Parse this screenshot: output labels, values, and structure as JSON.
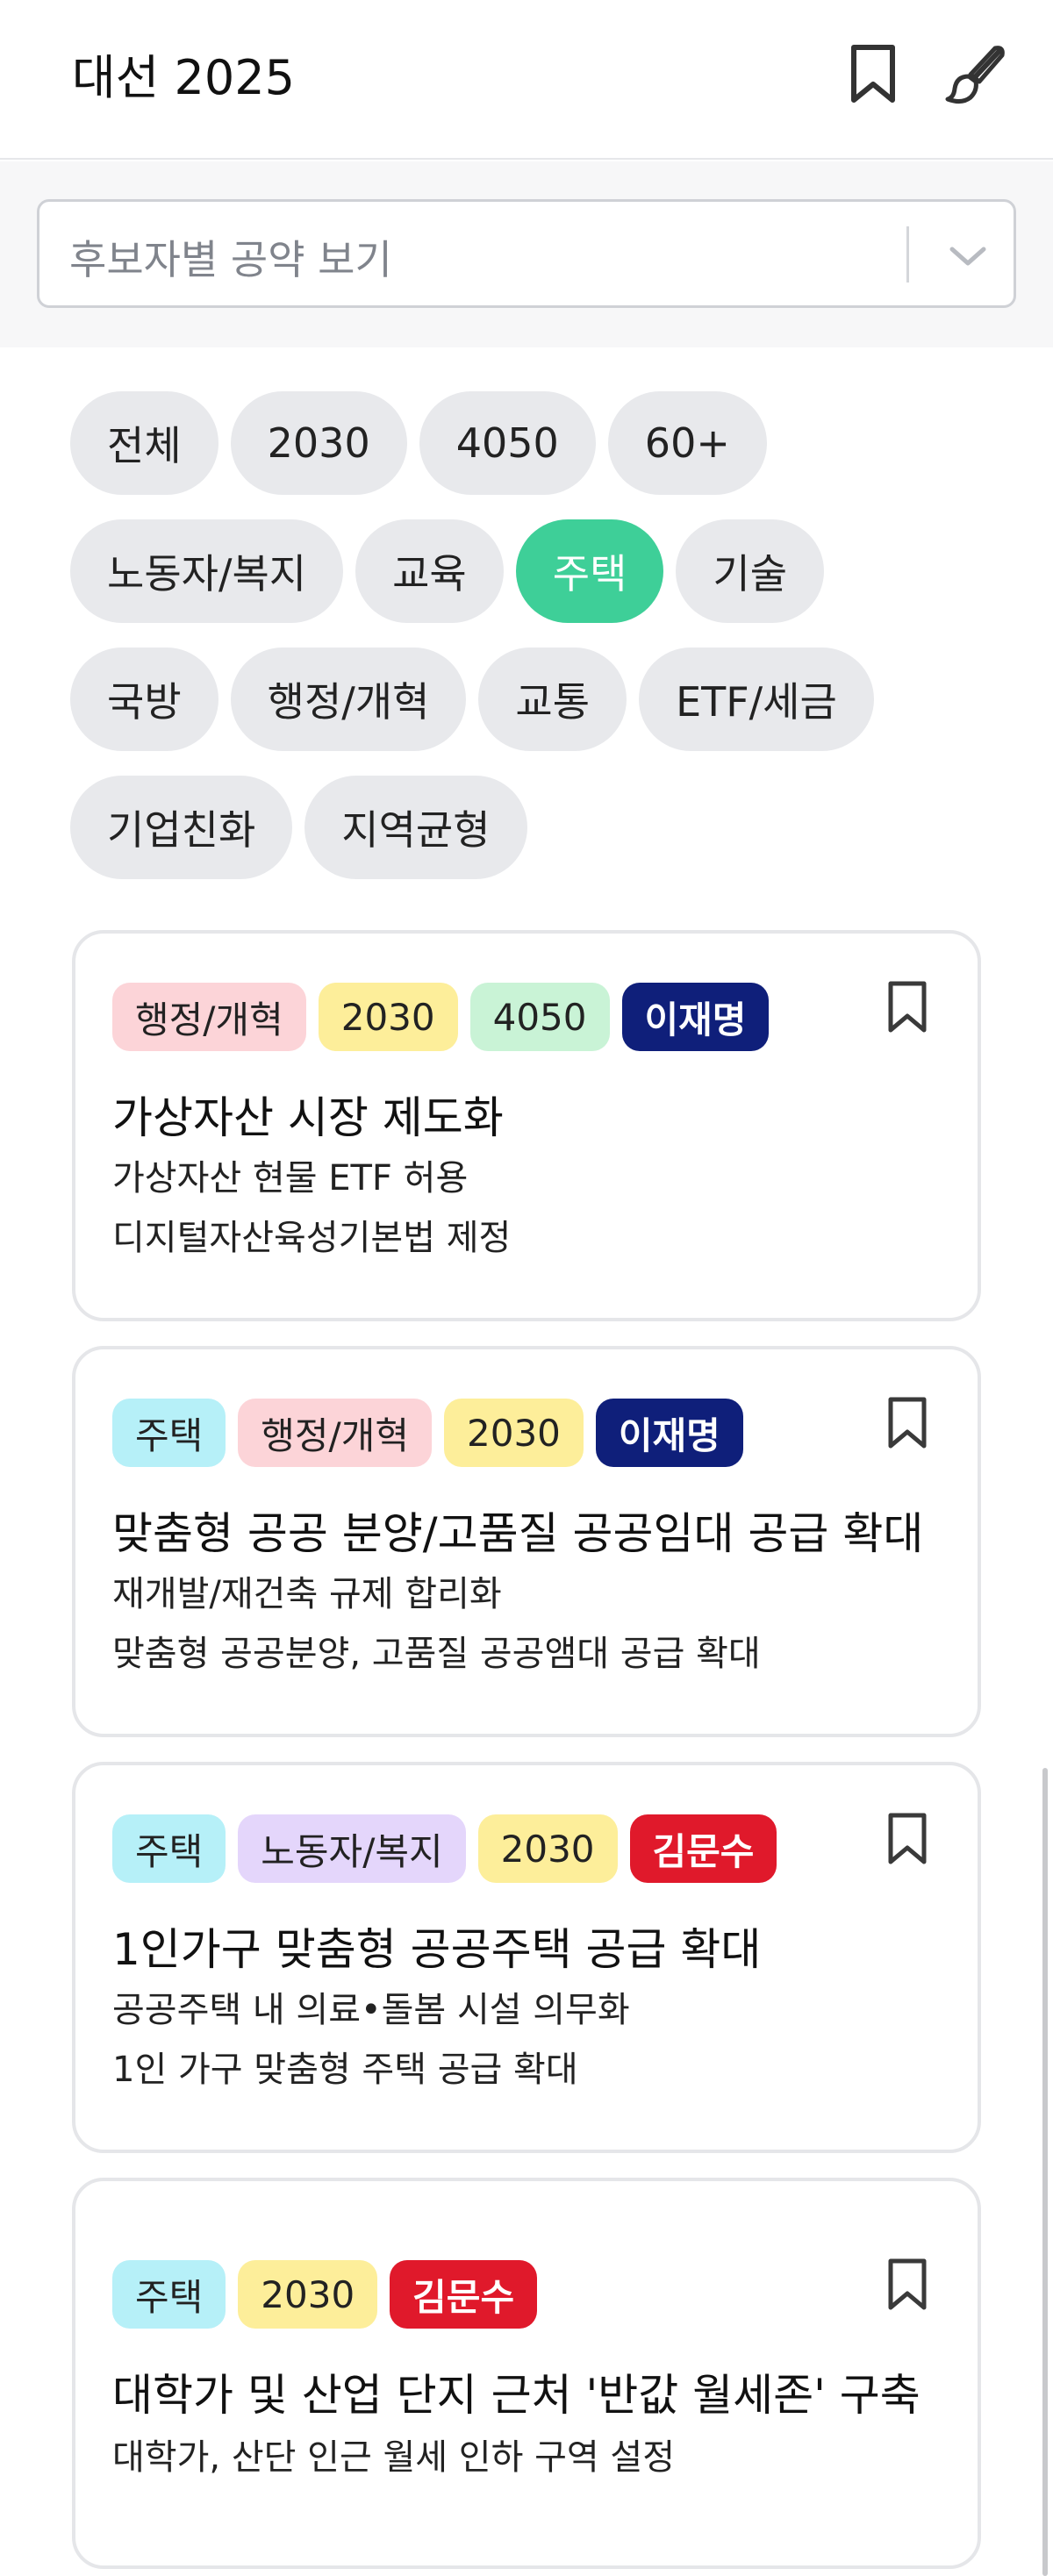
{
  "header": {
    "title": "대선 2025"
  },
  "select": {
    "placeholder": "후보자별 공약 보기"
  },
  "filters": {
    "rows": [
      [
        "전체",
        "2030",
        "4050",
        "60+"
      ],
      [
        "노동자/복지",
        "교육",
        "주택",
        "기술"
      ],
      [
        "국방",
        "행정/개혁",
        "교통",
        "ETF/세금"
      ],
      [
        "기업친화",
        "지역균형"
      ]
    ],
    "active": "주택"
  },
  "colors": {
    "accent": "#3ecf98",
    "tag_admin": "#fcd4d8",
    "tag_2030": "#fdee9a",
    "tag_4050": "#c9f3d6",
    "tag_housing": "#b6f0f8",
    "tag_labor": "#e4d6fb",
    "cand_lee": "#0f1f7a",
    "cand_kim": "#e0192b"
  },
  "cards": [
    {
      "tags": [
        {
          "label": "행정/개혁",
          "kind": "admin"
        },
        {
          "label": "2030",
          "kind": "2030"
        },
        {
          "label": "4050",
          "kind": "4050"
        },
        {
          "label": "이재명",
          "kind": "cand_lee"
        }
      ],
      "title": "가상자산 시장 제도화",
      "lines": [
        "가상자산 현물 ETF 허용",
        "디지털자산육성기본법 제정"
      ]
    },
    {
      "tags": [
        {
          "label": "주택",
          "kind": "housing"
        },
        {
          "label": "행정/개혁",
          "kind": "admin"
        },
        {
          "label": "2030",
          "kind": "2030"
        },
        {
          "label": "이재명",
          "kind": "cand_lee"
        }
      ],
      "title": "맞춤형 공공 분양/고품질 공공임대 공급 확대",
      "lines": [
        "재개발/재건축 규제 합리화",
        "맞춤형 공공분양, 고품질 공공앰대 공급 확대"
      ]
    },
    {
      "tags": [
        {
          "label": "주택",
          "kind": "housing"
        },
        {
          "label": "노동자/복지",
          "kind": "labor"
        },
        {
          "label": "2030",
          "kind": "2030"
        },
        {
          "label": "김문수",
          "kind": "cand_kim"
        }
      ],
      "title": "1인가구 맞춤형 공공주택 공급 확대",
      "lines": [
        "공공주택 내 의료•돌봄 시설 의무화",
        "1인 가구 맞춤형 주택 공급 확대"
      ]
    },
    {
      "tags": [
        {
          "label": "주택",
          "kind": "housing"
        },
        {
          "label": "2030",
          "kind": "2030"
        },
        {
          "label": "김문수",
          "kind": "cand_kim"
        }
      ],
      "title": "대학가 및 산업 단지 근처 '반값 월세존' 구축",
      "lines": [
        "대학가, 산단 인근 월세 인하 구역 설정"
      ]
    }
  ]
}
